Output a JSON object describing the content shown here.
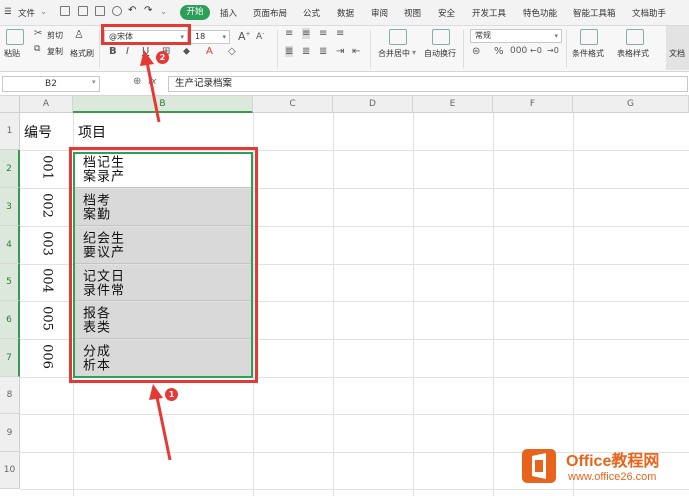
{
  "menubar": {
    "file_label": "文件",
    "tabs": [
      "开始",
      "插入",
      "页面布局",
      "公式",
      "数据",
      "审阅",
      "视图",
      "安全",
      "开发工具",
      "特色功能",
      "智能工具箱",
      "文档助手"
    ]
  },
  "ribbon": {
    "paste": "粘贴",
    "cut": "剪切",
    "copy": "复制",
    "format_painter": "格式刷",
    "font_name": "@宋体",
    "font_size": "18",
    "merge_center": "合并居中",
    "wrap_text": "自动换行",
    "number_format": "常规",
    "conditional_format": "条件格式",
    "table_style": "表格样式",
    "doc_helper": "文档"
  },
  "formula_bar": {
    "name_box": "B2",
    "fx": "fx",
    "content": "生产记录档案"
  },
  "sheet": {
    "columns": [
      "A",
      "B",
      "C",
      "D",
      "E",
      "F",
      "G"
    ],
    "rows": [
      "1",
      "2",
      "3",
      "4",
      "5",
      "6",
      "7",
      "8",
      "9",
      "10"
    ],
    "header_a": "编号",
    "header_b": "项目",
    "records": [
      {
        "num": "001",
        "item": "生产记录档案"
      },
      {
        "num": "002",
        "item": "考勤档案"
      },
      {
        "num": "003",
        "item": "生产会议纪要"
      },
      {
        "num": "004",
        "item": "日常文件记录"
      },
      {
        "num": "005",
        "item": "各类报表"
      },
      {
        "num": "006",
        "item": "成本分析"
      }
    ]
  },
  "annotations": {
    "badge1": "1",
    "badge2": "2"
  },
  "watermark": {
    "title": "Office教程网",
    "url": "www.office26.com"
  }
}
